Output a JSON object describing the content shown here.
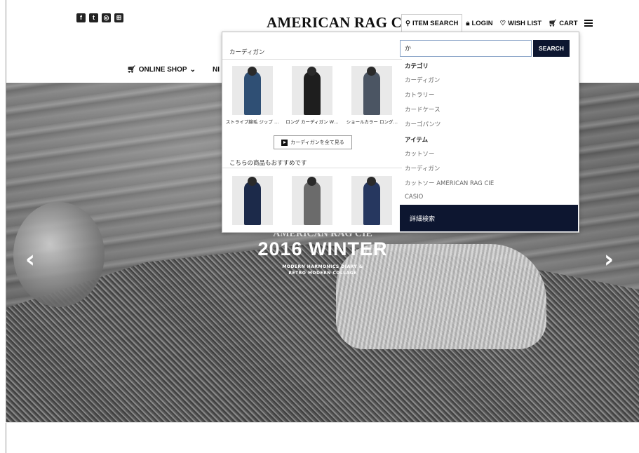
{
  "header": {
    "social_icons": [
      "facebook-icon",
      "twitter-icon",
      "instagram-icon",
      "line-icon"
    ],
    "logo": "AMERICAN RAG CIE",
    "nav": {
      "item_search": "ITEM SEARCH",
      "login": "LOGIN",
      "wish_list": "WISH LIST",
      "cart": "CART"
    }
  },
  "main_nav": {
    "online_shop": "ONLINE SHOP",
    "partial_next": "NI"
  },
  "hero": {
    "brand": "AMERICAN RAG CIE",
    "title": "2016 WINTER",
    "subtitle_line1": "MODERN HARMONICS DIARY &",
    "subtitle_line2": "RETRO MODERN COLLAGE"
  },
  "search_dropdown": {
    "results_heading": "カーディガン",
    "results": [
      {
        "name": "ストライプ綿毛 ジップ …",
        "color": "#2f4f74"
      },
      {
        "name": "ロング カーディガン W…",
        "color": "#1e1e1e"
      },
      {
        "name": "ショールカラー ロング…",
        "color": "#4b5563"
      }
    ],
    "see_all_label": "カーディガンを全て見る",
    "recommend_heading": "こちらの商品もおすすめです",
    "recommend": [
      {
        "color": "#1c2a4a"
      },
      {
        "color": "#6b6b6b"
      },
      {
        "color": "#26375f"
      }
    ],
    "search_value": "か",
    "search_button": "SEARCH",
    "category_head": "カテゴリ",
    "categories": [
      "カーディガン",
      "カトラリー",
      "カードケース",
      "カーゴパンツ"
    ],
    "item_head": "アイテム",
    "items": [
      "カットソー",
      "カーディガン",
      "カットソー AMERICAN RAG CIE",
      "CASIO"
    ],
    "advanced_search": "詳細検索"
  },
  "colors": {
    "navy": "#0d1630"
  }
}
